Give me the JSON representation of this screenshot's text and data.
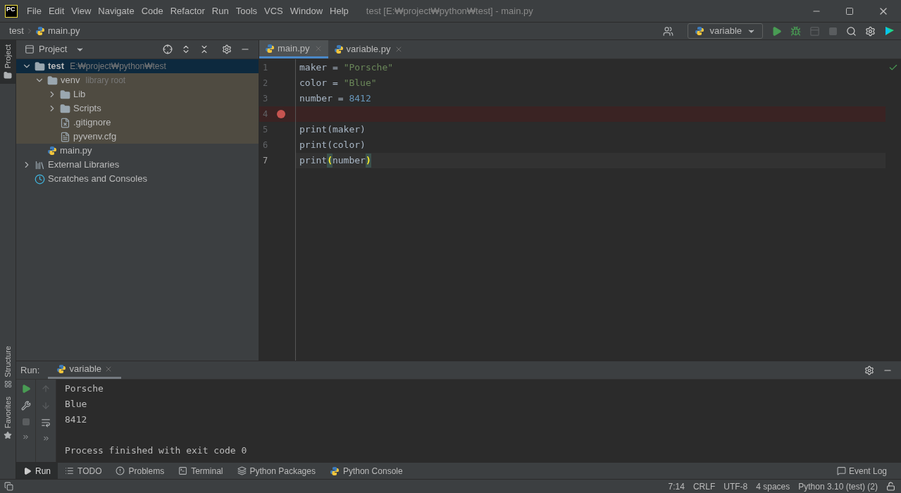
{
  "window": {
    "title": "test [E:₩project₩python₩test] - main.py",
    "logo": "PC"
  },
  "menu": [
    "File",
    "Edit",
    "View",
    "Navigate",
    "Code",
    "Refactor",
    "Run",
    "Tools",
    "VCS",
    "Window",
    "Help"
  ],
  "breadcrumbs": [
    "test",
    "main.py"
  ],
  "run_config": "variable",
  "left_stripe": [
    {
      "label": "Project",
      "selected": true
    },
    {
      "label": "Structure",
      "selected": false
    },
    {
      "label": "Favorites",
      "selected": false
    }
  ],
  "project_panel": {
    "title": "Project",
    "tree": [
      {
        "label": "test",
        "hint": "E:₩project₩python₩test",
        "kind": "folder",
        "expanded": true,
        "selected": true,
        "children": [
          {
            "label": "venv",
            "hint": "library root",
            "kind": "folder",
            "expanded": true,
            "selected": false,
            "library": true,
            "children": [
              {
                "label": "Lib",
                "kind": "folder",
                "expanded": false,
                "selected": false
              },
              {
                "label": "Scripts",
                "kind": "folder",
                "expanded": false,
                "selected": false
              },
              {
                "label": ".gitignore",
                "kind": "ignored",
                "selected": false
              },
              {
                "label": "pyvenv.cfg",
                "kind": "text",
                "selected": false
              }
            ]
          },
          {
            "label": "main.py",
            "kind": "python",
            "selected": false
          }
        ]
      },
      {
        "label": "External Libraries",
        "kind": "libraries",
        "expanded": false,
        "selected": false
      },
      {
        "label": "Scratches and Consoles",
        "kind": "scratches",
        "selected": false
      }
    ]
  },
  "editor_tabs": [
    {
      "label": "main.py",
      "selected": true
    },
    {
      "label": "variable.py",
      "selected": false
    }
  ],
  "code_lines": [
    {
      "number": "1",
      "breakpoint": false,
      "current": false,
      "tokens": [
        {
          "kind": "plain",
          "text": "maker = "
        },
        {
          "kind": "string",
          "text": "\"Porsche\""
        }
      ]
    },
    {
      "number": "2",
      "breakpoint": false,
      "current": false,
      "tokens": [
        {
          "kind": "plain",
          "text": "color = "
        },
        {
          "kind": "string",
          "text": "\"Blue\""
        }
      ]
    },
    {
      "number": "3",
      "breakpoint": false,
      "current": false,
      "tokens": [
        {
          "kind": "plain",
          "text": "number = "
        },
        {
          "kind": "number",
          "text": "8412"
        }
      ]
    },
    {
      "number": "4",
      "breakpoint": true,
      "current": false
    },
    {
      "number": "5",
      "breakpoint": false,
      "current": false,
      "tokens": [
        {
          "kind": "plain",
          "text": "print(maker)"
        }
      ]
    },
    {
      "number": "6",
      "breakpoint": false,
      "current": false,
      "tokens": [
        {
          "kind": "plain",
          "text": "print(color)"
        }
      ]
    },
    {
      "number": "7",
      "breakpoint": false,
      "current": true,
      "tokens": [
        {
          "kind": "plain",
          "text": "print"
        },
        {
          "kind": "match",
          "text": "("
        },
        {
          "kind": "plain",
          "text": "number"
        },
        {
          "kind": "match",
          "text": ")"
        }
      ]
    }
  ],
  "run_panel": {
    "label": "Run:",
    "tab": "variable",
    "output": [
      "Porsche",
      "Blue",
      "8412"
    ],
    "exit_message": "Process finished with exit code 0"
  },
  "tool_tabs": [
    {
      "label": "Run",
      "kind": "play",
      "selected": true
    },
    {
      "label": "TODO",
      "kind": "list",
      "selected": false
    },
    {
      "label": "Problems",
      "kind": "alert",
      "selected": false
    },
    {
      "label": "Terminal",
      "kind": "terminal",
      "selected": false
    },
    {
      "label": "Python Packages",
      "kind": "layers",
      "selected": false
    },
    {
      "label": "Python Console",
      "kind": "python",
      "selected": false
    }
  ],
  "event_log": "Event Log",
  "status_bar": [
    "7:14",
    "CRLF",
    "UTF-8",
    "4 spaces",
    "Python 3.10 (test) (2)"
  ]
}
